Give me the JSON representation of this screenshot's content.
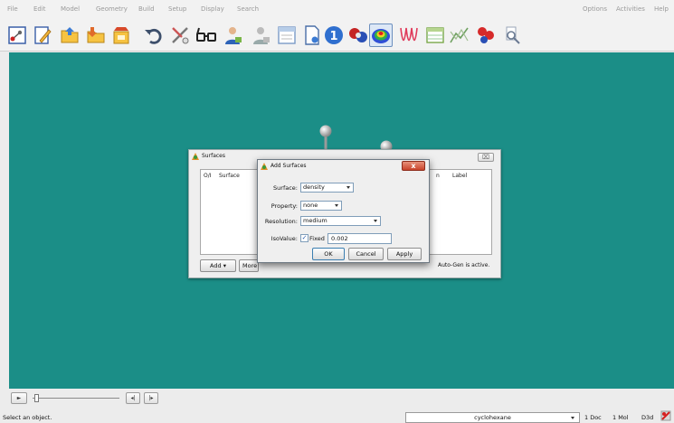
{
  "menu": {
    "items": [
      {
        "label": "File"
      },
      {
        "label": "Edit"
      },
      {
        "label": "Model"
      },
      {
        "label": "Geometry"
      },
      {
        "label": "Build"
      },
      {
        "label": "Setup"
      },
      {
        "label": "Display"
      },
      {
        "label": "Search"
      }
    ],
    "right_items": [
      {
        "label": "Options"
      },
      {
        "label": "Activities"
      },
      {
        "label": "Help"
      }
    ]
  },
  "toolbar": {
    "icons": [
      "new-molecule-icon",
      "edit-icon",
      "open-folder-icon",
      "import-icon",
      "save-icon",
      "undo-icon",
      "tools-icon",
      "view-glasses-icon",
      "builder-icon",
      "builder-disabled-icon",
      "calculator-icon",
      "document-icon",
      "info-icon",
      "molecule-icon",
      "surface-icon",
      "spectrum-icon",
      "table-icon",
      "graph-icon",
      "bio-icon",
      "search-icon"
    ]
  },
  "surfaces_dialog": {
    "title": "Surfaces",
    "close_glyph": "⌧",
    "columns": {
      "onoff": "O/I",
      "surface": "Surface",
      "hidden": "n",
      "label": "Label"
    },
    "add_label": "Add",
    "more_label": "More S",
    "status": "Auto-Gen is active."
  },
  "add_surfaces_dialog": {
    "title": "Add Surfaces",
    "close_glyph": "x",
    "surface_label": "Surface:",
    "surface_value": "density",
    "property_label": "Property:",
    "property_value": "none",
    "resolution_label": "Resolution:",
    "resolution_value": "medium",
    "isovalue_label": "IsoValue:",
    "fixed_checked": true,
    "fixed_check_glyph": "✓",
    "fixed_label": "Fixed",
    "isovalue_value": "0.002",
    "ok_label": "OK",
    "cancel_label": "Cancel",
    "apply_label": "Apply"
  },
  "bottom": {
    "play_glyph": "►",
    "prev_glyph": "◂|",
    "next_glyph": "|▸",
    "status": "Select an object.",
    "document": "cyclohexane",
    "doc_count": "1 Doc",
    "mol_count": "1 Mol",
    "render_mode": "D3d"
  },
  "colors": {
    "viewport": "#1b8e87",
    "accent_close": "#c9432b"
  }
}
